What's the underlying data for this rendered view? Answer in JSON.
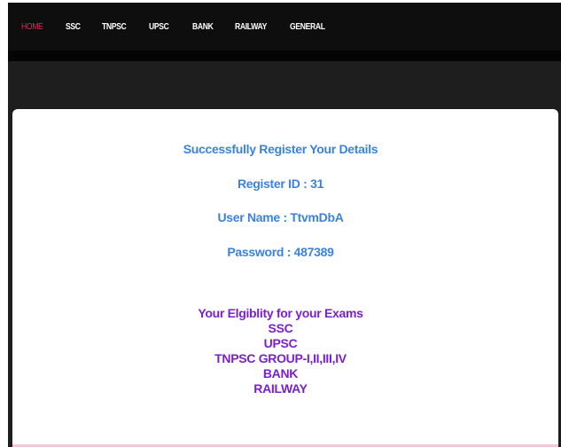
{
  "nav": {
    "items": [
      "HOME",
      "SSC",
      "TNPSC",
      "UPSC",
      "BANK",
      "RAILWAY",
      "GENERAL"
    ],
    "active_index": 0
  },
  "registration": {
    "success_message": "Successfully Register Your Details",
    "register_id": "Register ID : 31",
    "user_name": "User Name : TtvmDbA",
    "password": "Password : 487389"
  },
  "eligibility": {
    "heading": "Your Elgiblity for your Exams",
    "exams": [
      "SSC",
      "UPSC",
      "TNPSC GROUP-I,II,III,IV",
      "BANK",
      "RAILWAY"
    ]
  },
  "colors": {
    "nav_background": "#0e0e0e",
    "nav_active": "#e0245a",
    "info_text": "#3b82e0",
    "eligibility_text": "#7a1fd1"
  }
}
